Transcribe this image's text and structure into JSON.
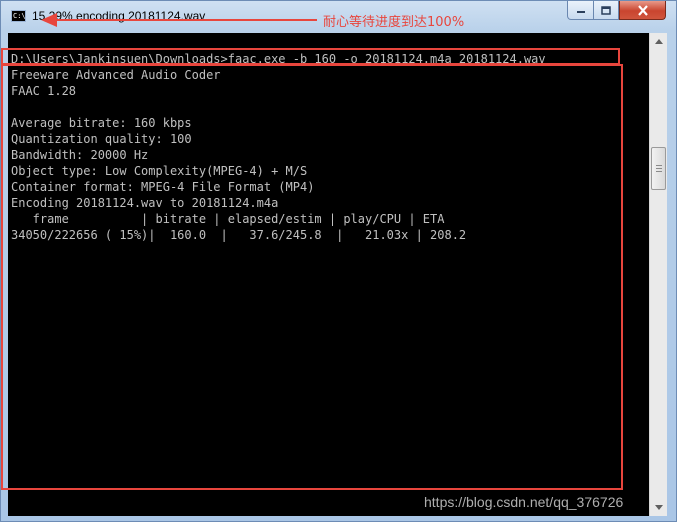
{
  "window": {
    "title": "15.29% encoding 20181124.wav",
    "icon": "console-icon",
    "buttons": {
      "minimize": "minimize-icon",
      "maximize": "maximize-icon",
      "close": "close-icon"
    }
  },
  "annotation": {
    "text": "耐心等待进度到达100%",
    "color": "#e8463d"
  },
  "console": {
    "lines": [
      "D:\\Users\\Jankinsuen\\Downloads>faac.exe -b 160 -o 20181124.m4a 20181124.wav",
      "Freeware Advanced Audio Coder",
      "FAAC 1.28",
      "",
      "Average bitrate: 160 kbps",
      "Quantization quality: 100",
      "Bandwidth: 20000 Hz",
      "Object type: Low Complexity(MPEG-4) + M/S",
      "Container format: MPEG-4 File Format (MP4)",
      "Encoding 20181124.wav to 20181124.m4a",
      "   frame          | bitrate | elapsed/estim | play/CPU | ETA",
      "34050/222656 ( 15%)|  160.0  |   37.6/245.8  |   21.03x | 208.2"
    ]
  },
  "watermark": "https://blog.csdn.net/qq_376726"
}
